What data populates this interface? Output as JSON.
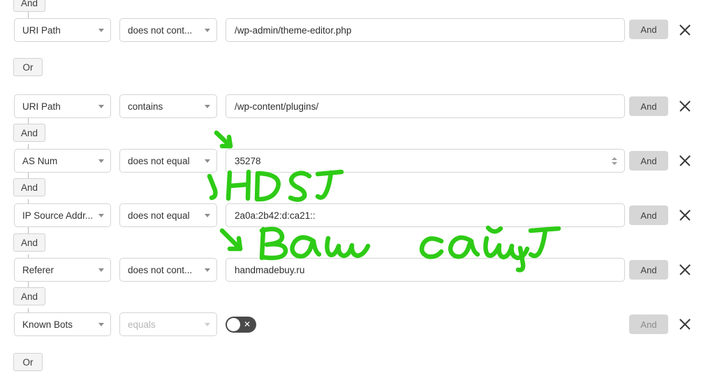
{
  "accent": {
    "ink_green": "#2ECB16",
    "toggle_track": "#4a4a4a",
    "chip_bg": "#f4f4f4",
    "and_bg": "#d6d6d6"
  },
  "logic_chips": [
    {
      "label": "And",
      "name": "logic-chip-and-top"
    },
    {
      "label": "Or",
      "name": "logic-chip-or-upper"
    },
    {
      "label": "And",
      "name": "logic-chip-and-1"
    },
    {
      "label": "And",
      "name": "logic-chip-and-2"
    },
    {
      "label": "And",
      "name": "logic-chip-and-3"
    },
    {
      "label": "And",
      "name": "logic-chip-and-4"
    },
    {
      "label": "Or",
      "name": "logic-chip-or-bottom"
    }
  ],
  "rows": [
    {
      "field": "URI Path",
      "operator": "does not cont...",
      "value": "/wp-admin/theme-editor.php",
      "value_type": "text",
      "and_label": "And",
      "and_muted": false,
      "operator_disabled": false,
      "has_toggle": false
    },
    {
      "field": "URI Path",
      "operator": "contains",
      "value": "/wp-content/plugins/",
      "value_type": "text",
      "and_label": "And",
      "and_muted": false,
      "operator_disabled": false,
      "has_toggle": false
    },
    {
      "field": "AS Num",
      "operator": "does not equal",
      "value": "35278",
      "value_type": "number",
      "and_label": "And",
      "and_muted": false,
      "operator_disabled": false,
      "has_toggle": false
    },
    {
      "field": "IP Source Addr...",
      "operator": "does not equal",
      "value": "2a0a:2b42:d:ca21::",
      "value_type": "text",
      "and_label": "And",
      "and_muted": false,
      "operator_disabled": false,
      "has_toggle": false
    },
    {
      "field": "Referer",
      "operator": "does not cont...",
      "value": "handmadebuy.ru",
      "value_type": "text",
      "and_label": "And",
      "and_muted": false,
      "operator_disabled": false,
      "has_toggle": false
    },
    {
      "field": "Known Bots",
      "operator": "equals",
      "value": "",
      "value_type": "toggle",
      "and_label": "And",
      "and_muted": true,
      "operator_disabled": true,
      "has_toggle": true,
      "toggle_state": "off",
      "toggle_glyph": "✕"
    }
  ],
  "annotations": [
    {
      "name": "annotation-host",
      "text": "ХОСТ",
      "transliteration": "HOST"
    },
    {
      "name": "annotation-your-site",
      "text": "Ваш сайт",
      "transliteration": "Vash sayt"
    }
  ]
}
